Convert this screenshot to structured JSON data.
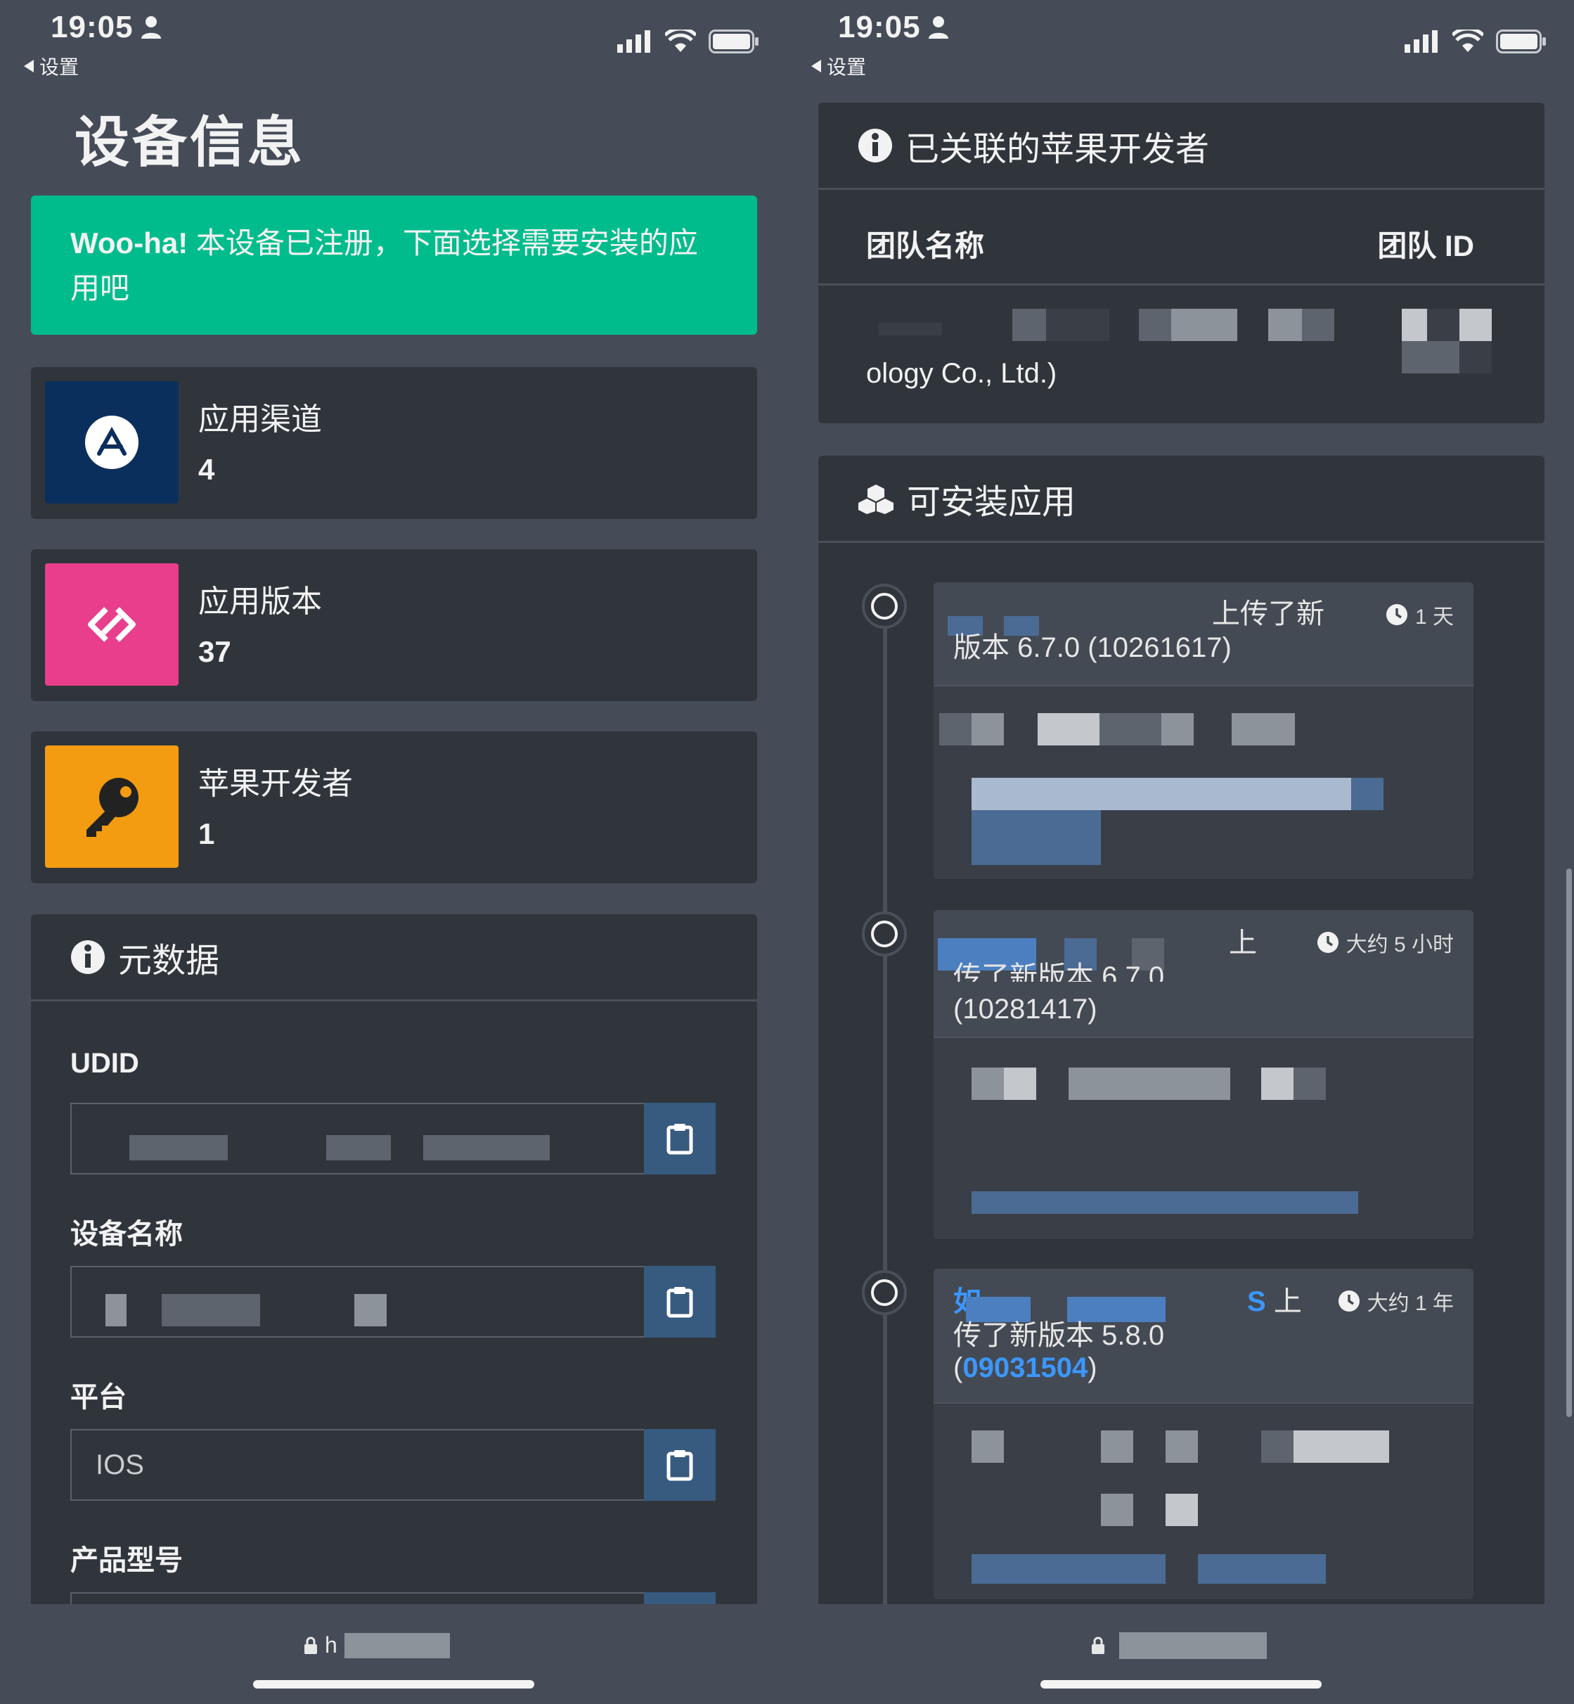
{
  "left": {
    "status": {
      "time": "19:05",
      "back_label": "设置"
    },
    "page_title": "设备信息",
    "alert": {
      "strong": "Woo-ha!",
      "text": " 本设备已注册，下面选择需要安装的应用吧"
    },
    "stats": [
      {
        "label": "应用渠道",
        "value": "4",
        "icon": "app-store-icon",
        "color": "#0b2f5c"
      },
      {
        "label": "应用版本",
        "value": "37",
        "icon": "code-branch-icon",
        "color": "#e83e8c"
      },
      {
        "label": "苹果开发者",
        "value": "1",
        "icon": "key-icon",
        "color": "#f39c12"
      }
    ],
    "metadata": {
      "title": "元数据",
      "fields": [
        {
          "label": "UDID",
          "value": ""
        },
        {
          "label": "设备名称",
          "value": ""
        },
        {
          "label": "平台",
          "value": "IOS"
        },
        {
          "label": "产品型号",
          "value": ""
        }
      ]
    },
    "url": "h"
  },
  "right": {
    "status": {
      "time": "19:05",
      "back_label": "设置"
    },
    "developers": {
      "title": "已关联的苹果开发者",
      "columns": [
        "团队名称",
        "团队 ID"
      ],
      "rows": [
        {
          "team_name": "ology Co., Ltd.)",
          "team_id": ""
        }
      ]
    },
    "apps": {
      "title": "可安装应用",
      "items": [
        {
          "head_a": "上传了新",
          "head_b": "版本 6.7.0 (10261617)",
          "time": "1 天"
        },
        {
          "head_a": "上",
          "head_b": "传了新版本 6.7.0",
          "head_c": "(10281417)",
          "time": "大约 5 小时"
        },
        {
          "head_a": "如",
          "head_a2": "S 上",
          "head_b": "传了新版本 5.8.0",
          "head_c_open": "(",
          "head_c_link": "09031504",
          "head_c_close": ")",
          "time": "大约 1 年"
        }
      ]
    },
    "url": ""
  }
}
